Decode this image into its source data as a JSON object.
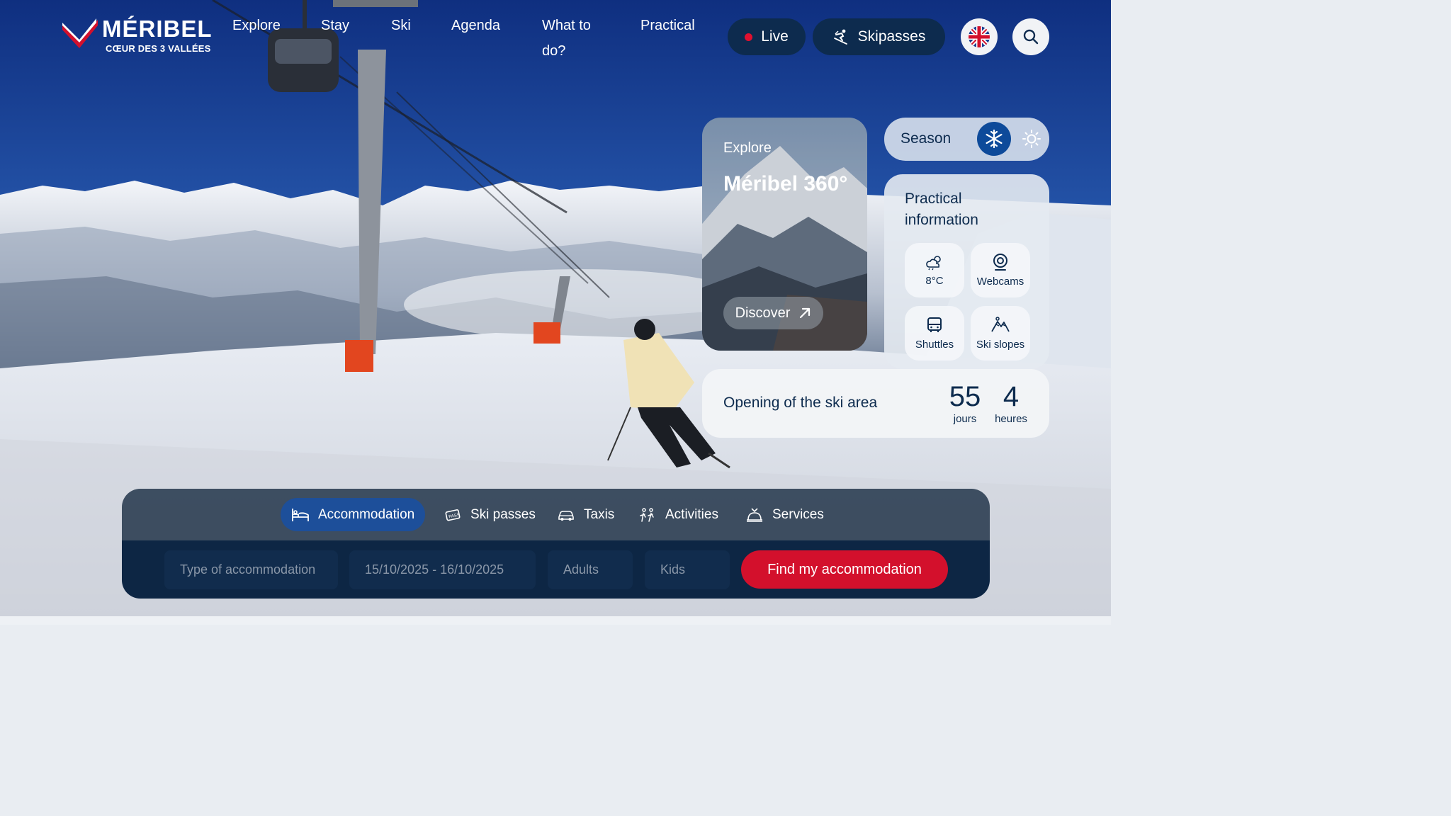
{
  "brand": {
    "name": "MÉRIBEL",
    "tagline": "CŒUR DES 3 VALLÉES"
  },
  "nav": {
    "items": [
      "Explore",
      "Stay",
      "Ski",
      "Agenda",
      "What to",
      "do?",
      "Practical"
    ]
  },
  "header_actions": {
    "live_label": "Live",
    "skipasses_label": "Skipasses",
    "language_icon": "uk-flag-icon",
    "search_icon": "search-icon"
  },
  "explore_card": {
    "kicker": "Explore",
    "title": "Méribel 360°",
    "button_label": "Discover"
  },
  "season": {
    "label": "Season",
    "options": [
      "winter",
      "summer"
    ],
    "selected": "winter"
  },
  "practical": {
    "title": "Practical information",
    "tiles": [
      {
        "label": "8°C",
        "icon": "weather-icon"
      },
      {
        "label": "Webcams",
        "icon": "webcam-icon"
      },
      {
        "label": "Shuttles",
        "icon": "bus-icon"
      },
      {
        "label": "Ski slopes",
        "icon": "slopes-icon"
      }
    ]
  },
  "opening": {
    "label": "Opening of the ski area",
    "days_value": "55",
    "days_unit": "jours",
    "hours_value": "4",
    "hours_unit": "heures"
  },
  "booking": {
    "tabs": [
      {
        "label": "Accommodation",
        "icon": "bed-icon",
        "active": true
      },
      {
        "label": "Ski passes",
        "icon": "pass-icon",
        "active": false
      },
      {
        "label": "Taxis",
        "icon": "car-icon",
        "active": false
      },
      {
        "label": "Activities",
        "icon": "activities-icon",
        "active": false
      },
      {
        "label": "Services",
        "icon": "services-icon",
        "active": false
      }
    ],
    "fields": {
      "type_placeholder": "Type of accommodation",
      "dates_value": "15/10/2025 - 16/10/2025",
      "adults_placeholder": "Adults",
      "kids_placeholder": "Kids"
    },
    "submit_label": "Find my accommodation"
  },
  "colors": {
    "navy": "#0d2b4e",
    "accent_red": "#d3102c",
    "active_tab_blue": "#1d4f9a"
  }
}
